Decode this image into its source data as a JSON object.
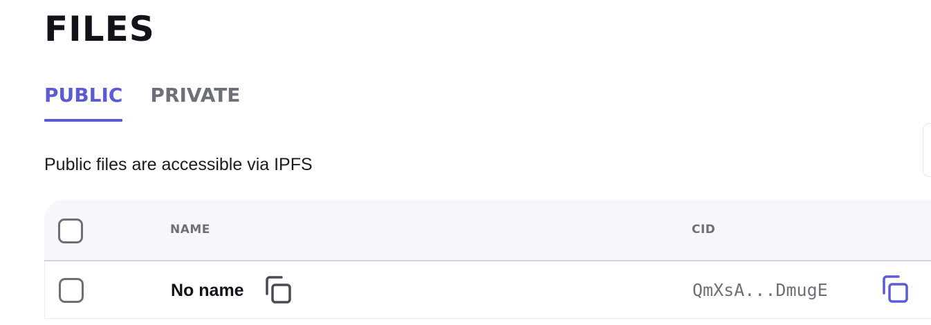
{
  "page": {
    "title": "FILES",
    "description": "Public files are accessible via IPFS"
  },
  "tabs": [
    {
      "label": "PUBLIC",
      "active": true
    },
    {
      "label": "PRIVATE",
      "active": false
    }
  ],
  "table": {
    "columns": {
      "name": "NAME",
      "cid": "CID"
    },
    "rows": [
      {
        "name": "No name",
        "cid": "QmXsA...DmugE"
      }
    ]
  },
  "icons": {
    "select_all": "checkbox-icon",
    "row_select": "checkbox-icon",
    "copy_name": "copy-icon",
    "copy_cid": "copy-icon"
  },
  "colors": {
    "accent": "#5b5bd6",
    "text_primary": "#12121a",
    "text_muted": "#6e7079",
    "checkbox_border": "#6e6e78",
    "header_bg": "#f6f6fb",
    "header_border": "#d2d2dc",
    "copy_name_icon": "#4a4a55",
    "copy_cid_icon": "#5b5bd6"
  }
}
